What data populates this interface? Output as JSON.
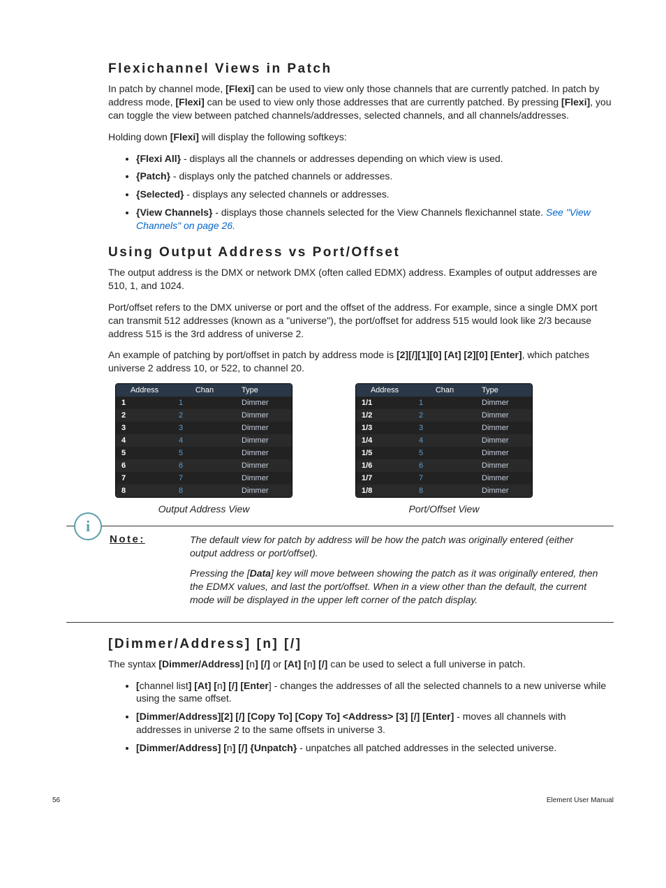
{
  "h_flex": "Flexichannel Views in Patch",
  "flex_p1_a": "In patch by channel mode, ",
  "flex_p1_b": "[Flexi]",
  "flex_p1_c": " can be used to view only those channels that are currently patched. In patch by address mode, ",
  "flex_p1_d": "[Flexi]",
  "flex_p1_e": " can be used to view only those addresses that are currently patched. By pressing ",
  "flex_p1_f": "[Flexi]",
  "flex_p1_g": ", you can toggle the view between patched channels/addresses, selected channels, and all channels/addresses.",
  "flex_p2_a": "Holding down ",
  "flex_p2_b": "[Flexi]",
  "flex_p2_c": " will display the following softkeys:",
  "li_flexall_a": "{Flexi All}",
  "li_flexall_b": " - displays all the channels or addresses depending on which view is used.",
  "li_patch_a": "{Patch}",
  "li_patch_b": " - displays only the patched channels or addresses.",
  "li_selected_a": "{Selected}",
  "li_selected_b": " - displays any selected channels or addresses.",
  "li_viewch_a": "{View Channels}",
  "li_viewch_b": " - displays those channels selected for the View Channels flexichannel state. ",
  "li_viewch_link": "See \"View Channels\" on page 26.",
  "h_output": "Using Output Address vs Port/Offset",
  "out_p1": "The output address is the DMX or network DMX (often called EDMX) address. Examples of output addresses are 510, 1, and 1024.",
  "out_p2": "Port/offset refers to the DMX universe or port and the offset of the address. For example, since a single DMX port can transmit 512 addresses (known as a \"universe\"), the port/offset for address 515 would look like 2/3 because address 515 is the 3rd address of universe 2.",
  "out_p3_a": "An example of patching by port/offset in patch by address mode is ",
  "out_p3_b": "[2][/][1][0] [At] [2][0] [Enter]",
  "out_p3_c": ", which patches universe 2 address 10, or 522, to channel 20.",
  "table_headers": {
    "address": "Address",
    "chan": "Chan",
    "type": "Type"
  },
  "table_left": [
    {
      "addr": "1",
      "chan": "1",
      "type": "Dimmer"
    },
    {
      "addr": "2",
      "chan": "2",
      "type": "Dimmer"
    },
    {
      "addr": "3",
      "chan": "3",
      "type": "Dimmer"
    },
    {
      "addr": "4",
      "chan": "4",
      "type": "Dimmer"
    },
    {
      "addr": "5",
      "chan": "5",
      "type": "Dimmer"
    },
    {
      "addr": "6",
      "chan": "6",
      "type": "Dimmer"
    },
    {
      "addr": "7",
      "chan": "7",
      "type": "Dimmer"
    },
    {
      "addr": "8",
      "chan": "8",
      "type": "Dimmer"
    }
  ],
  "table_right": [
    {
      "addr": "1/1",
      "chan": "1",
      "type": "Dimmer"
    },
    {
      "addr": "1/2",
      "chan": "2",
      "type": "Dimmer"
    },
    {
      "addr": "1/3",
      "chan": "3",
      "type": "Dimmer"
    },
    {
      "addr": "1/4",
      "chan": "4",
      "type": "Dimmer"
    },
    {
      "addr": "1/5",
      "chan": "5",
      "type": "Dimmer"
    },
    {
      "addr": "1/6",
      "chan": "6",
      "type": "Dimmer"
    },
    {
      "addr": "1/7",
      "chan": "7",
      "type": "Dimmer"
    },
    {
      "addr": "1/8",
      "chan": "8",
      "type": "Dimmer"
    }
  ],
  "caption_left": "Output Address View",
  "caption_right": "Port/Offset View",
  "note_label": "Note:",
  "note_p1_a": "The default view for patch by address will be how the patch was originally entered (either output address or port/offset).",
  "note_p2_a": "Pressing the [",
  "note_p2_b": "Data",
  "note_p2_c": "] key will move between showing the patch as it was originally entered, then the EDMX values, and last the port/offset. When in a view other than the default, the current mode will be displayed in the upper left corner of the patch display.",
  "h_dimmer": "[Dimmer/Address] [n] [/]",
  "dim_p1_a": "The syntax ",
  "dim_p1_b": "[Dimmer/Address] [",
  "dim_p1_c": "n",
  "dim_p1_d": "] [/]",
  "dim_p1_e": " or ",
  "dim_p1_f": "[At] [",
  "dim_p1_g": "n",
  "dim_p1_h": "] [/]",
  "dim_p1_i": " can be used to select a full universe in patch.",
  "dli1_a": "[",
  "dli1_b": "channel list",
  "dli1_c": "] [At] [",
  "dli1_d": "n",
  "dli1_e": "] [/] [Enter",
  "dli1_f": "] - changes the addresses of all the selected channels to a new universe while using the same offset.",
  "dli2_a": "[Dimmer/Address][2] [/] [Copy To] [Copy To] <Address> [3] [/] [Enter]",
  "dli2_b": " - moves all channels with addresses in universe 2 to the same offsets in universe 3.",
  "dli3_a": "[Dimmer/Address] [",
  "dli3_b": "n",
  "dli3_c": "] [/] {Unpatch}",
  "dli3_d": " - unpatches all patched addresses in the selected universe.",
  "page_num": "56",
  "doc_title": "Element User Manual"
}
